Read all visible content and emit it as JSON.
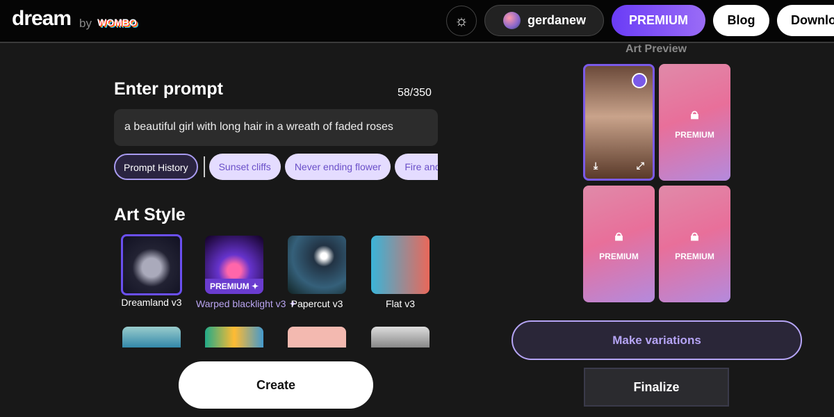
{
  "header": {
    "logo": "dream",
    "by": "by",
    "brand": "WOMBO",
    "username": "gerdanew",
    "premium": "PREMIUM",
    "blog": "Blog",
    "download": "Download"
  },
  "prompt": {
    "title": "Enter prompt",
    "count": "58/350",
    "value": "a beautiful girl with long hair in a wreath of faded roses",
    "history": "Prompt History",
    "suggestions": [
      "Sunset cliffs",
      "Never ending flower",
      "Fire and water"
    ]
  },
  "art_style": {
    "title": "Art Style",
    "styles": [
      {
        "label": "Dreamland v3",
        "selected": true
      },
      {
        "label": "Warped blacklight v3 ✦",
        "badge": "PREMIUM ✦"
      },
      {
        "label": "Papercut v3"
      },
      {
        "label": "Flat v3"
      }
    ]
  },
  "create": "Create",
  "preview": {
    "title": "Art Preview",
    "locked_label": "PREMIUM",
    "make_variations": "Make variations",
    "finalize": "Finalize"
  },
  "colors": {
    "accent": "#6a3cf6",
    "chip_bg": "#e4dcff"
  }
}
